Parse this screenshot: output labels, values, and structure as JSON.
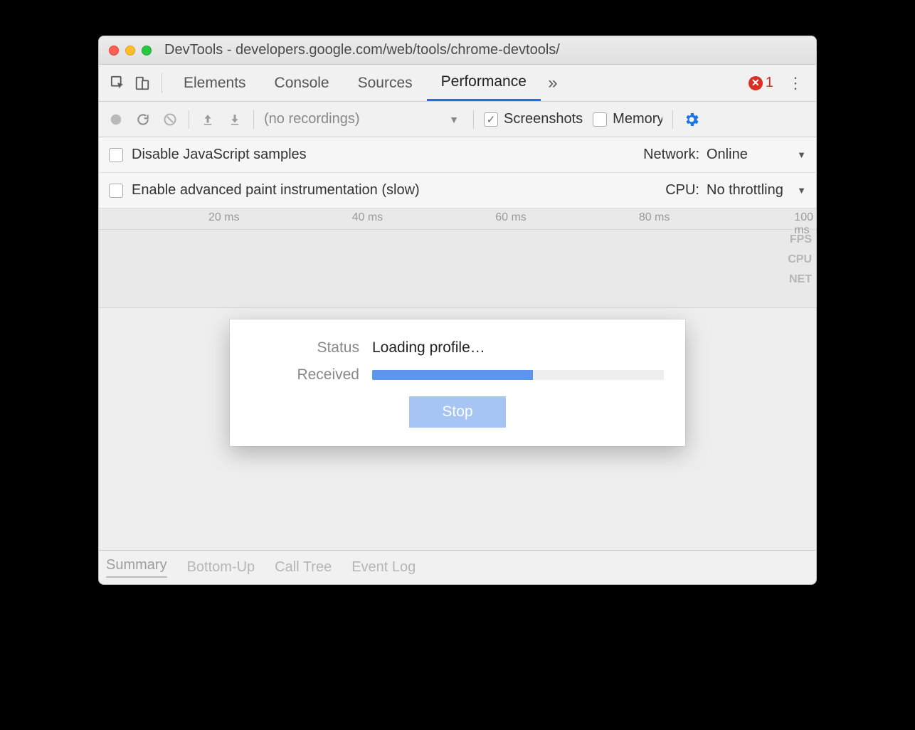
{
  "titlebar": {
    "title": "DevTools - developers.google.com/web/tools/chrome-devtools/"
  },
  "tabbar": {
    "tabs": [
      "Elements",
      "Console",
      "Sources",
      "Performance"
    ],
    "active_index": 3,
    "overflow_glyph": "»",
    "error_count": "1"
  },
  "toolbar": {
    "recordings_label": "(no recordings)",
    "screenshots_label": "Screenshots",
    "screenshots_checked": true,
    "memory_label": "Memory",
    "memory_checked": false
  },
  "options": {
    "disable_js_label": "Disable JavaScript samples",
    "disable_js_checked": false,
    "paint_instr_label": "Enable advanced paint instrumentation (slow)",
    "paint_instr_checked": false,
    "network_label": "Network:",
    "network_value": "Online",
    "cpu_label": "CPU:",
    "cpu_value": "No throttling"
  },
  "timeline": {
    "ticks": [
      "20 ms",
      "40 ms",
      "60 ms",
      "80 ms",
      "100 ms"
    ],
    "lanes": [
      "FPS",
      "CPU",
      "NET"
    ]
  },
  "dialog": {
    "status_label": "Status",
    "status_value": "Loading profile…",
    "received_label": "Received",
    "progress_percent": 55,
    "stop_label": "Stop"
  },
  "bottom_tabs": {
    "tabs": [
      "Summary",
      "Bottom-Up",
      "Call Tree",
      "Event Log"
    ],
    "active_index": 0
  }
}
